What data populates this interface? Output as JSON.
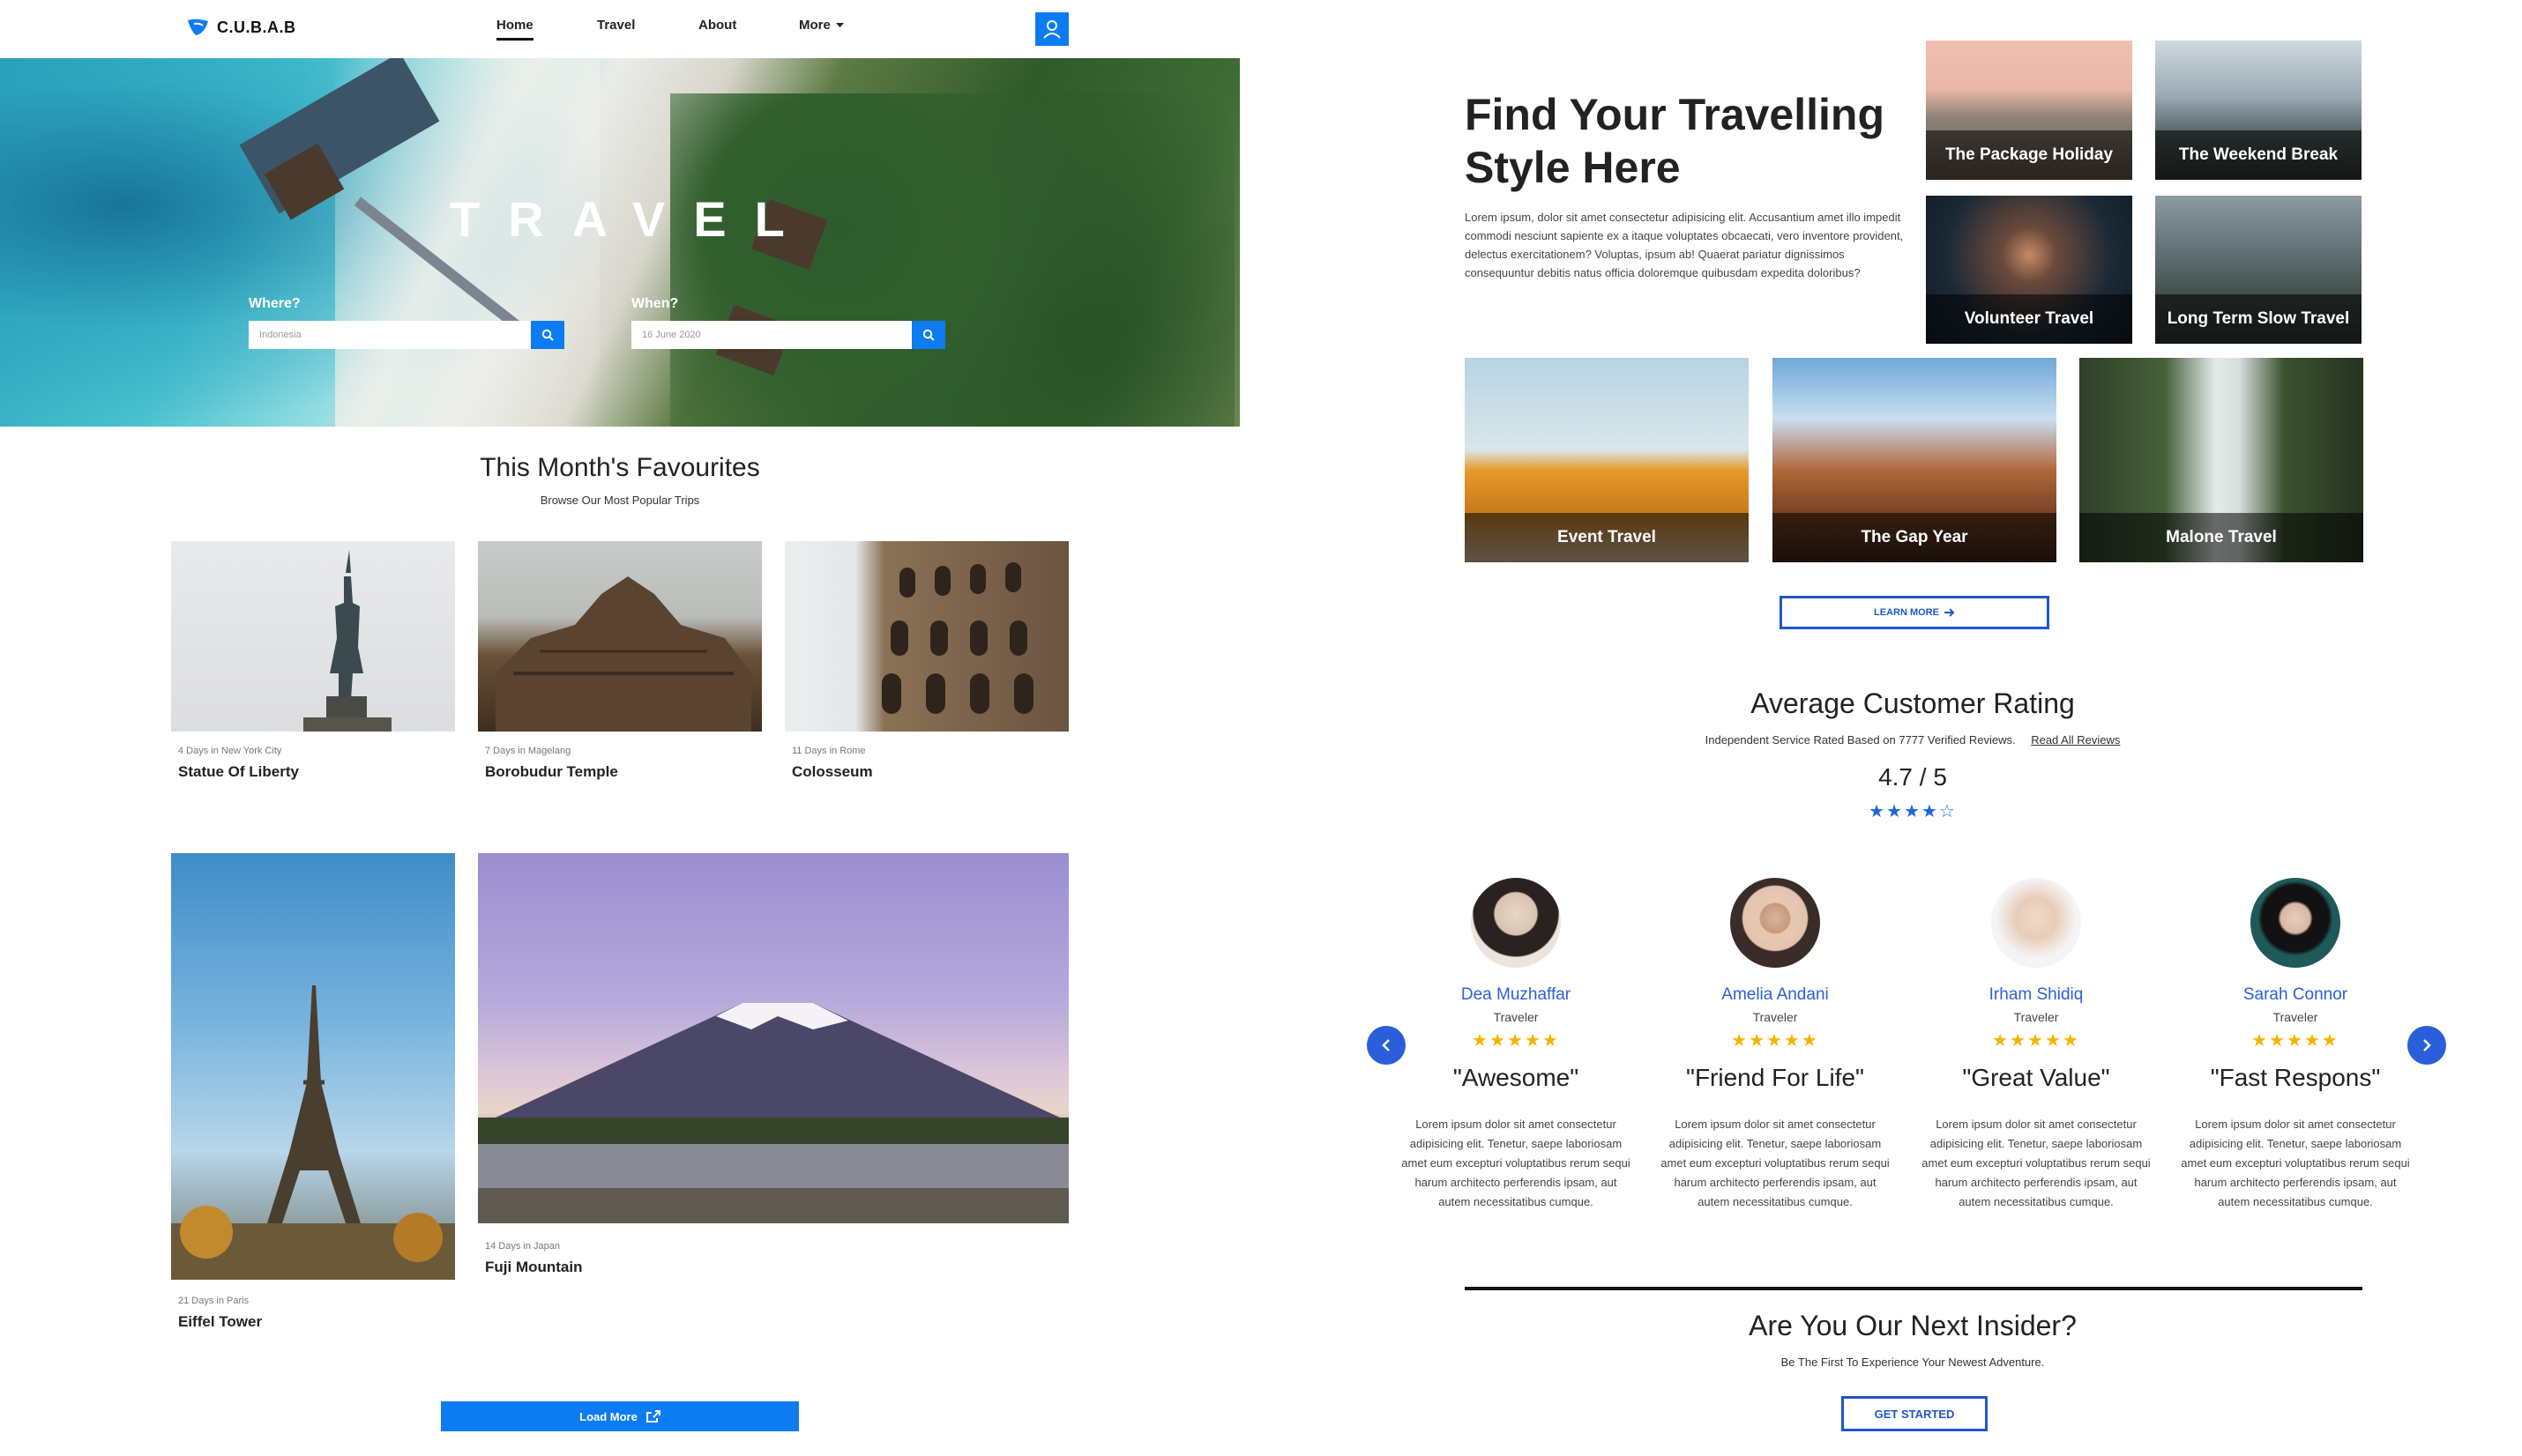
{
  "nav": {
    "logo_text": "C.U.B.A.B",
    "links": [
      {
        "label": "Home",
        "active": true
      },
      {
        "label": "Travel"
      },
      {
        "label": "About"
      },
      {
        "label": "More"
      }
    ],
    "user_icon": "user-icon",
    "more_icon": "caret-down-icon"
  },
  "hero": {
    "title": "TRAVEL",
    "where_label": "Where?",
    "where_value": "Indonesia",
    "when_label": "When?",
    "when_value": "16 June 2020",
    "search_icon": "search-icon"
  },
  "favourites": {
    "title": "This Month's Favourites",
    "subtitle": "Browse Our Most Popular Trips",
    "cards": [
      {
        "meta": "4 Days in New York City",
        "name": "Statue Of Liberty"
      },
      {
        "meta": "7 Days in Magelang",
        "name": "Borobudur Temple"
      },
      {
        "meta": "11 Days in Rome",
        "name": "Colosseum"
      },
      {
        "meta": "21 Days in Paris",
        "name": "Eiffel Tower"
      },
      {
        "meta": "14 Days in Japan",
        "name": "Fuji Mountain"
      }
    ],
    "load_more": "Load More"
  },
  "styles": {
    "title": "Find Your Travelling Style Here",
    "text": "Lorem ipsum, dolor sit amet consectetur adipisicing elit. Accusantium amet illo impedit commodi nesciunt sapiente ex a itaque voluptates obcaecati, vero inventore provident, delectus exercitationem? Voluptas, ipsum ab! Quaerat pariatur dignissimos consequuntur debitis natus officia doloremque quibusdam expedita doloribus?",
    "tiles": [
      {
        "label": "The Package Holiday"
      },
      {
        "label": "The Weekend Break"
      },
      {
        "label": "Volunteer Travel"
      },
      {
        "label": "Long Term Slow Travel"
      },
      {
        "label": "Event Travel"
      },
      {
        "label": "The Gap Year"
      },
      {
        "label": "Malone Travel"
      }
    ],
    "learn_more": "LEARN MORE"
  },
  "rating": {
    "title": "Average Customer Rating",
    "subtitle": "Independent Service Rated Based on 7777 Verified Reviews.",
    "read_all": "Read All Reviews",
    "score": "4.7 / 5",
    "stars": "★★★★☆",
    "star_value": 4.7
  },
  "reviews": [
    {
      "name": "Dea Muzhaffar",
      "role": "Traveler",
      "stars": "★★★★★",
      "quote": "\"Awesome\"",
      "text": "Lorem ipsum dolor sit amet consectetur adipisicing elit. Tenetur, saepe laboriosam amet eum excepturi voluptatibus rerum sequi harum architecto perferendis ipsam, aut autem necessitatibus cumque."
    },
    {
      "name": "Amelia Andani",
      "role": "Traveler",
      "stars": "★★★★★",
      "quote": "\"Friend For Life\"",
      "text": "Lorem ipsum dolor sit amet consectetur adipisicing elit. Tenetur, saepe laboriosam amet eum excepturi voluptatibus rerum sequi harum architecto perferendis ipsam, aut autem necessitatibus cumque."
    },
    {
      "name": "Irham Shidiq",
      "role": "Traveler",
      "stars": "★★★★★",
      "quote": "\"Great Value\"",
      "text": "Lorem ipsum dolor sit amet consectetur adipisicing elit. Tenetur, saepe laboriosam amet eum excepturi voluptatibus rerum sequi harum architecto perferendis ipsam, aut autem necessitatibus cumque."
    },
    {
      "name": "Sarah Connor",
      "role": "Traveler",
      "stars": "★★★★★",
      "quote": "\"Fast Respons\"",
      "text": "Lorem ipsum dolor sit amet consectetur adipisicing elit. Tenetur, saepe laboriosam amet eum excepturi voluptatibus rerum sequi harum architecto perferendis ipsam, aut autem necessitatibus cumque."
    }
  ],
  "insider": {
    "title": "Are You Our Next Insider?",
    "subtitle": "Be The First To Experience Your Newest Adventure.",
    "button": "GET STARTED"
  },
  "colors": {
    "accent": "#0d7cf2",
    "brand_blue": "#2b5fd9",
    "star_yellow": "#f5b400"
  }
}
